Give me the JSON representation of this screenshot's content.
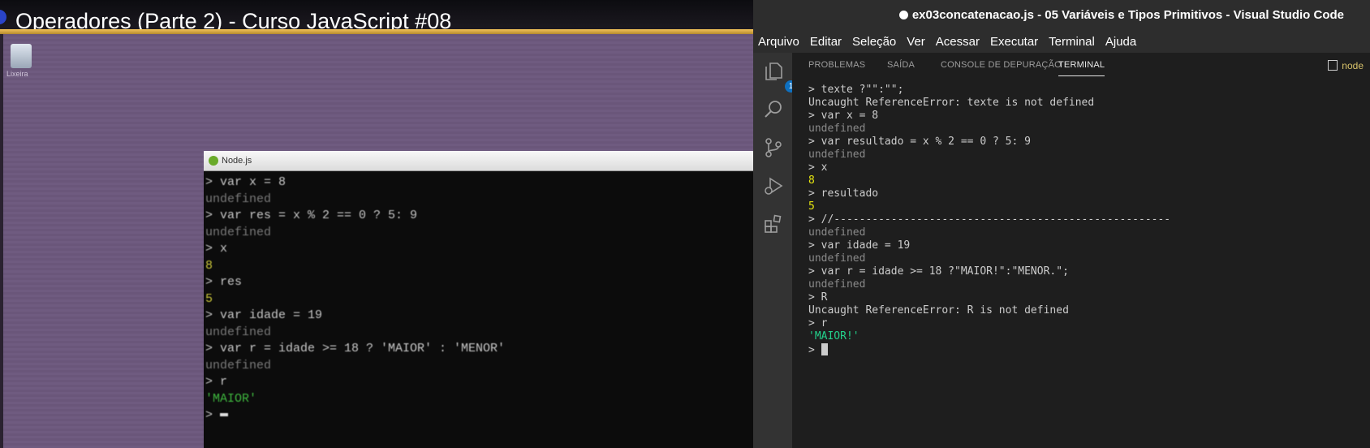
{
  "video": {
    "title": "Operadores (Parte 2) - Curso JavaScript #08",
    "desktop_icon_label": "Lixeira",
    "node_window_title": "Node.js",
    "console_lines": [
      {
        "text": "> var x = 8",
        "style": "white"
      },
      {
        "text": "undefined",
        "style": "gray"
      },
      {
        "text": "> var res = x % 2 == 0 ? 5: 9",
        "style": "white"
      },
      {
        "text": "undefined",
        "style": "gray"
      },
      {
        "text": "> x",
        "style": "white"
      },
      {
        "text": "8",
        "style": "yellow"
      },
      {
        "text": "> res",
        "style": "white"
      },
      {
        "text": "5",
        "style": "yellow"
      },
      {
        "text": "> var idade = 19",
        "style": "white"
      },
      {
        "text": "undefined",
        "style": "gray"
      },
      {
        "text": "> var r = idade >= 18 ? 'MAIOR' : 'MENOR'",
        "style": "white"
      },
      {
        "text": "undefined",
        "style": "gray"
      },
      {
        "text": "> r",
        "style": "white"
      },
      {
        "text": "'MAIOR'",
        "style": "green"
      },
      {
        "text": "> ",
        "style": "prompt"
      }
    ]
  },
  "vscode": {
    "window_title": "ex03concatenacao.js - 05 Variáveis e Tipos Primitivos - Visual Studio Code",
    "menu": [
      "Arquivo",
      "Editar",
      "Seleção",
      "Ver",
      "Acessar",
      "Executar",
      "Terminal",
      "Ajuda"
    ],
    "explorer_badge": "1",
    "panel_tabs": [
      "PROBLEMAS",
      "SAÍDA",
      "CONSOLE DE DEPURAÇÃO",
      "TERMINAL"
    ],
    "active_tab": "TERMINAL",
    "terminal_label": "node",
    "terminal_lines": [
      {
        "text": "> texte ?\"\":\"\";",
        "style": "white"
      },
      {
        "text": "Uncaught ReferenceError: texte is not defined",
        "style": "white"
      },
      {
        "text": "> var x = 8",
        "style": "white"
      },
      {
        "text": "undefined",
        "style": "gray"
      },
      {
        "text": "> var resultado = x % 2 == 0 ? 5: 9",
        "style": "white"
      },
      {
        "text": "undefined",
        "style": "gray"
      },
      {
        "text": "> x",
        "style": "white"
      },
      {
        "text": "8",
        "style": "yellow"
      },
      {
        "text": "> resultado",
        "style": "white"
      },
      {
        "text": "5",
        "style": "yellow"
      },
      {
        "text": "> //-----------------------------------------------------",
        "style": "white"
      },
      {
        "text": "undefined",
        "style": "gray"
      },
      {
        "text": "> var idade = 19",
        "style": "white"
      },
      {
        "text": "undefined",
        "style": "gray"
      },
      {
        "text": "> var r = idade >= 18 ?\"MAIOR!\":\"MENOR.\";",
        "style": "white"
      },
      {
        "text": "undefined",
        "style": "gray"
      },
      {
        "text": "> R",
        "style": "white"
      },
      {
        "text": "Uncaught ReferenceError: R is not defined",
        "style": "white"
      },
      {
        "text": "> r",
        "style": "white"
      },
      {
        "text": "'MAIOR!'",
        "style": "green"
      },
      {
        "text": "> ",
        "style": "prompt"
      }
    ],
    "activity_icons": [
      "files-icon",
      "search-icon",
      "source-control-icon",
      "run-debug-icon",
      "extensions-icon"
    ]
  }
}
